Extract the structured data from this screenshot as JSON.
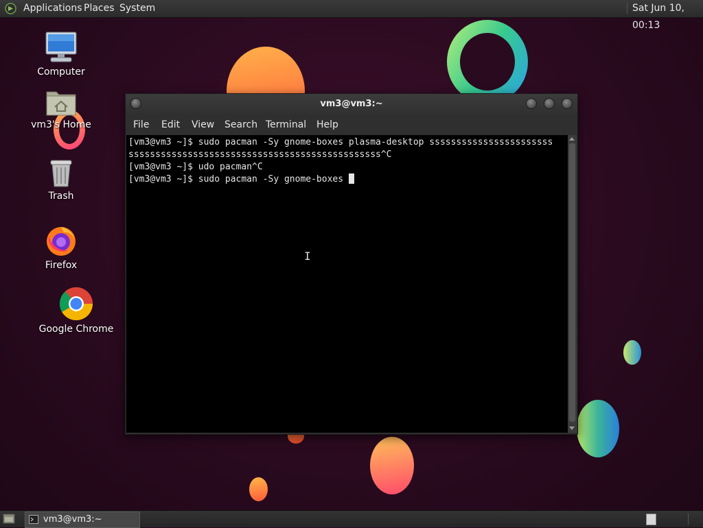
{
  "top_panel": {
    "menus": [
      "Applications",
      "Places",
      "System"
    ],
    "clock": "Sat Jun 10, 00:13"
  },
  "desktop": {
    "icons": [
      {
        "label": "Computer",
        "icon": "computer-icon"
      },
      {
        "label": "vm3's Home",
        "icon": "home-folder-icon"
      },
      {
        "label": "Trash",
        "icon": "trash-icon"
      },
      {
        "label": "Firefox",
        "icon": "firefox-icon"
      },
      {
        "label": "Google Chrome",
        "icon": "chrome-icon"
      }
    ]
  },
  "terminal": {
    "title": "vm3@vm3:~",
    "menu": [
      "File",
      "Edit",
      "View",
      "Search",
      "Terminal",
      "Help"
    ],
    "lines": [
      "[vm3@vm3 ~]$ sudo pacman -Sy gnome-boxes plasma-desktop sssssssssssssssssssssss",
      "sssssssssssssssssssssssssssssssssssssssssssssss^C",
      "[vm3@vm3 ~]$ udo pacman^C",
      "[vm3@vm3 ~]$ sudo pacman -Sy gnome-boxes "
    ]
  },
  "bottom_panel": {
    "task_label": "vm3@vm3:~"
  },
  "colors": {
    "desktop_bg": "#2a0a1f",
    "panel_bg": "#2b2b2b",
    "terminal_bg": "#000000",
    "terminal_fg": "#e6e6e6"
  }
}
